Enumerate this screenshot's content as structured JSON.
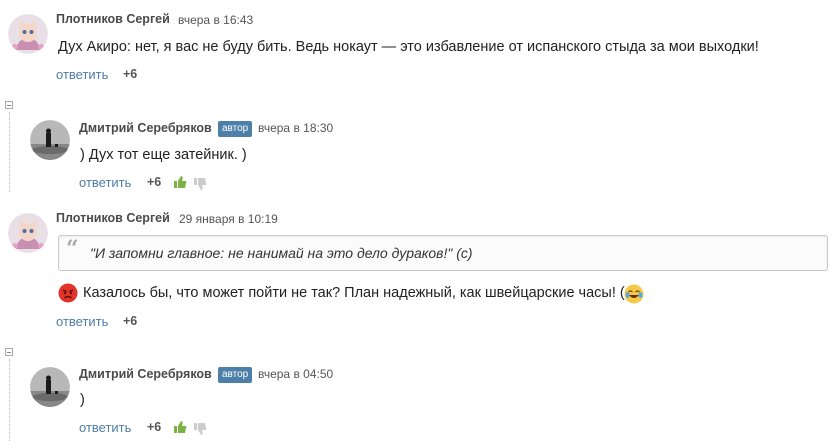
{
  "comments": [
    {
      "author": "Плотников Сергей",
      "date": "вчера в 16:43",
      "text": "Дух Акиро: нет, я вас не буду бить. Ведь нокаут — это избавление от испанского стыда за мои выходки!",
      "reply_label": "ответить",
      "score": "+6"
    },
    {
      "author": "Дмитрий Серебряков",
      "badge": "автор",
      "date": "вчера в 18:30",
      "text": ") Дух тот еще затейник. )",
      "reply_label": "ответить",
      "score": "+6"
    },
    {
      "author": "Плотников Сергей",
      "date": "29 января в 10:19",
      "quote": "\"И запомни главное: не нанимай на это дело дураков!\" (с)",
      "text": "Казалось бы, что может пойти не так? План надежный, как швейцарские часы! (с)",
      "reply_label": "ответить",
      "score": "+6"
    },
    {
      "author": "Дмитрий Серебряков",
      "badge": "автор",
      "date": "вчера в 04:50",
      "text": ")",
      "reply_label": "ответить",
      "score": "+6"
    }
  ],
  "colors": {
    "link": "#4f7ca6",
    "badge": "#4e7fa8",
    "thumb_up": "#7cb342",
    "thumb_down": "#cccccc"
  }
}
